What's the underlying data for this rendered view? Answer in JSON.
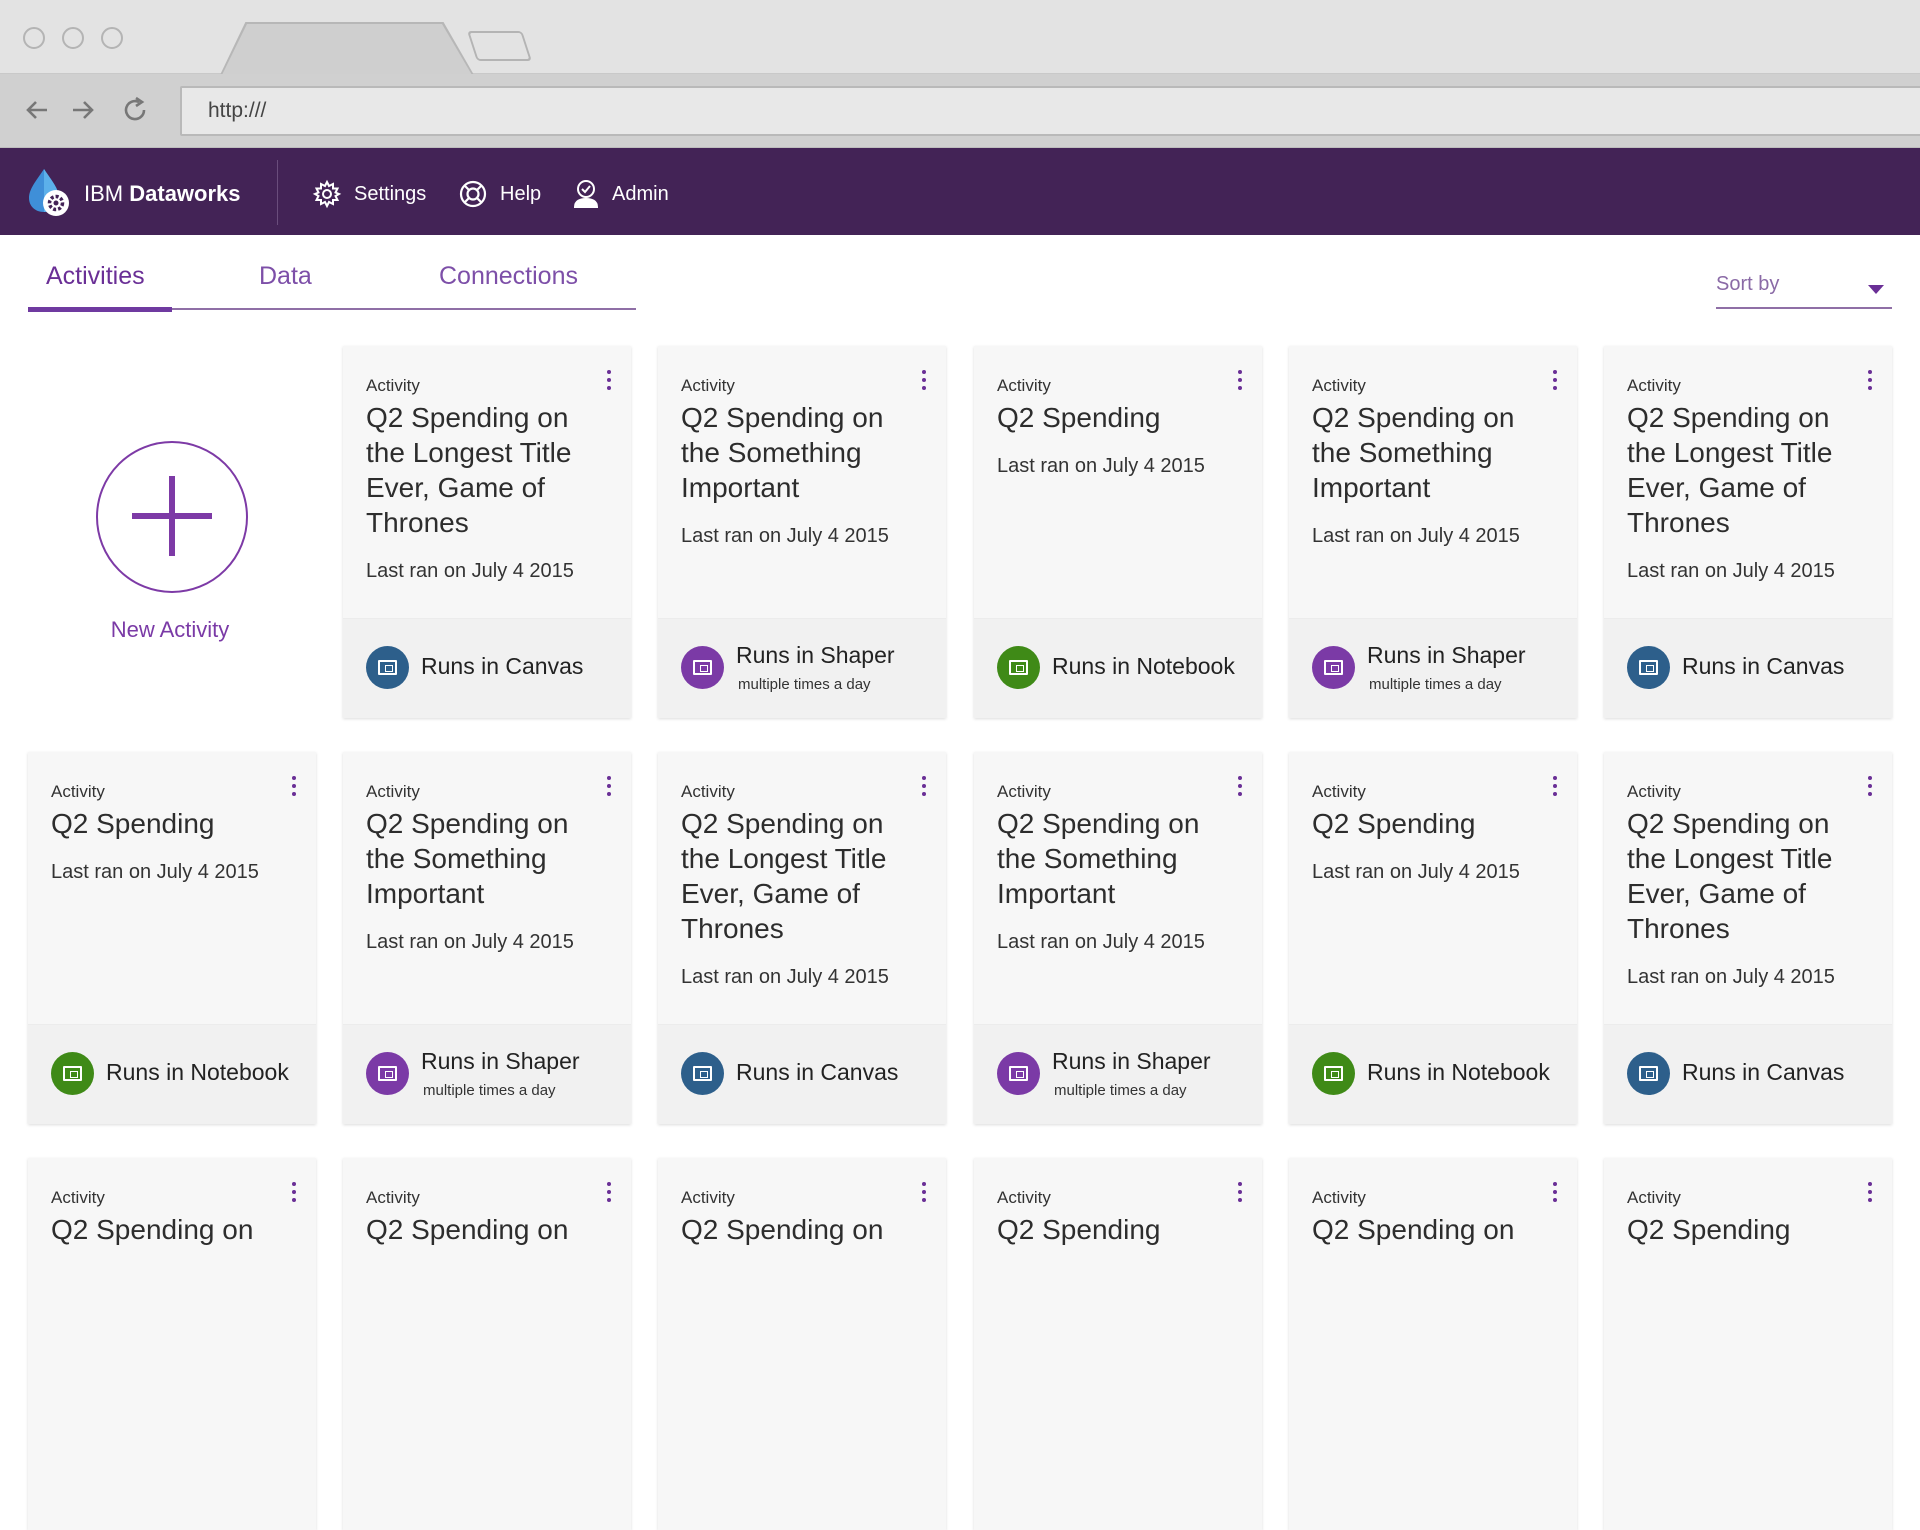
{
  "browser": {
    "url": "http:///"
  },
  "header": {
    "brand_prefix": "IBM",
    "brand_name": "Dataworks",
    "nav": [
      {
        "label": "Settings",
        "icon": "gear-icon"
      },
      {
        "label": "Help",
        "icon": "lifebuoy-icon"
      },
      {
        "label": "Admin",
        "icon": "admin-user-icon"
      }
    ]
  },
  "tabs": [
    {
      "label": "Activities",
      "active": true
    },
    {
      "label": "Data",
      "active": false
    },
    {
      "label": "Connections",
      "active": false
    }
  ],
  "sort": {
    "label": "Sort by"
  },
  "new_activity": {
    "label": "New Activity"
  },
  "colors": {
    "header_bg": "#432356",
    "accent": "#6a2f96",
    "canvas": "#2d5f8b",
    "shaper": "#7b3aa6",
    "notebook": "#3f8a17"
  },
  "cards": [
    {
      "kicker": "Activity",
      "title": "Q2 Spending on the Longest Title Ever, Game of Thrones",
      "last_ran": "Last ran on July 4 2015",
      "runs_in": "Runs in Canvas",
      "runs_sub": "",
      "kind": "canvas"
    },
    {
      "kicker": "Activity",
      "title": "Q2 Spending on the Something Important",
      "last_ran": "Last ran on July 4 2015",
      "runs_in": "Runs in Shaper",
      "runs_sub": "multiple times a day",
      "kind": "shaper"
    },
    {
      "kicker": "Activity",
      "title": "Q2 Spending",
      "last_ran": "Last ran on July 4 2015",
      "runs_in": "Runs in Notebook",
      "runs_sub": "",
      "kind": "notebook"
    },
    {
      "kicker": "Activity",
      "title": "Q2 Spending on the Something Important",
      "last_ran": "Last ran on July 4 2015",
      "runs_in": "Runs in Shaper",
      "runs_sub": "multiple times a day",
      "kind": "shaper"
    },
    {
      "kicker": "Activity",
      "title": "Q2 Spending on the Longest Title Ever, Game of Thrones",
      "last_ran": "Last ran on July 4 2015",
      "runs_in": "Runs in Canvas",
      "runs_sub": "",
      "kind": "canvas"
    },
    {
      "kicker": "Activity",
      "title": "Q2 Spending",
      "last_ran": "Last ran on July 4 2015",
      "runs_in": "Runs in Notebook",
      "runs_sub": "",
      "kind": "notebook"
    },
    {
      "kicker": "Activity",
      "title": "Q2 Spending on the Something Important",
      "last_ran": "Last ran on July 4 2015",
      "runs_in": "Runs in Shaper",
      "runs_sub": "multiple times a day",
      "kind": "shaper"
    },
    {
      "kicker": "Activity",
      "title": "Q2 Spending on the Longest Title Ever, Game of Thrones",
      "last_ran": "Last ran on July 4 2015",
      "runs_in": "Runs in Canvas",
      "runs_sub": "",
      "kind": "canvas"
    },
    {
      "kicker": "Activity",
      "title": "Q2 Spending on the Something Important",
      "last_ran": "Last ran on July 4 2015",
      "runs_in": "Runs in Shaper",
      "runs_sub": "multiple times a day",
      "kind": "shaper"
    },
    {
      "kicker": "Activity",
      "title": "Q2 Spending",
      "last_ran": "Last ran on July 4 2015",
      "runs_in": "Runs in Notebook",
      "runs_sub": "",
      "kind": "notebook"
    },
    {
      "kicker": "Activity",
      "title": "Q2 Spending on the Longest Title Ever, Game of Thrones",
      "last_ran": "Last ran on July 4 2015",
      "runs_in": "Runs in Canvas",
      "runs_sub": "",
      "kind": "canvas"
    },
    {
      "kicker": "Activity",
      "title": "Q2 Spending on",
      "last_ran": "",
      "runs_in": "",
      "runs_sub": "",
      "kind": "canvas"
    },
    {
      "kicker": "Activity",
      "title": "Q2 Spending on",
      "last_ran": "",
      "runs_in": "",
      "runs_sub": "",
      "kind": "canvas"
    },
    {
      "kicker": "Activity",
      "title": "Q2 Spending on",
      "last_ran": "",
      "runs_in": "",
      "runs_sub": "",
      "kind": "canvas"
    },
    {
      "kicker": "Activity",
      "title": "Q2 Spending",
      "last_ran": "",
      "runs_in": "",
      "runs_sub": "",
      "kind": "canvas"
    },
    {
      "kicker": "Activity",
      "title": "Q2 Spending on",
      "last_ran": "",
      "runs_in": "",
      "runs_sub": "",
      "kind": "canvas"
    },
    {
      "kicker": "Activity",
      "title": "Q2 Spending",
      "last_ran": "",
      "runs_in": "",
      "runs_sub": "",
      "kind": "canvas"
    }
  ]
}
